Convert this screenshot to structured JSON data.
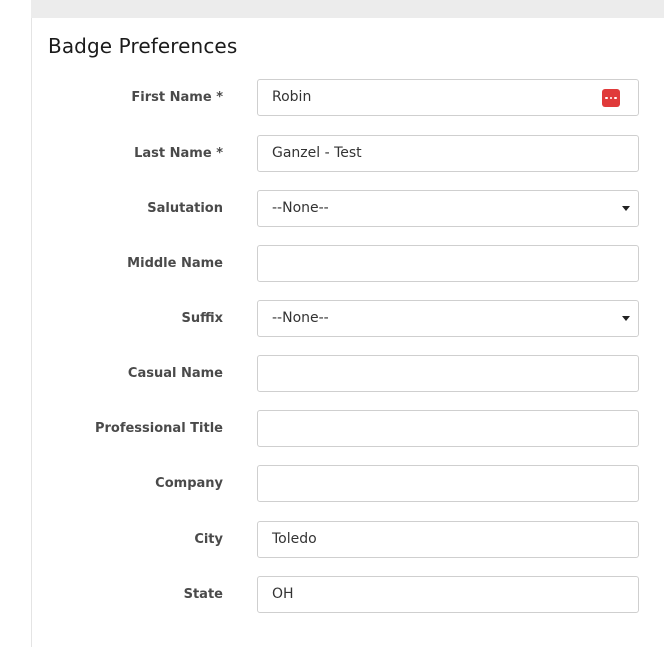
{
  "section_title": "Badge Preferences",
  "colors": {
    "top_strip": "#ececec",
    "label_text": "#4a4a4a",
    "field_border": "#cfcfcf",
    "password_icon": "#e03a3a"
  },
  "fields": {
    "first_name": {
      "label": "First Name *",
      "value": "Robin",
      "icon": "password-manager-icon"
    },
    "last_name": {
      "label": "Last Name *",
      "value": "Ganzel - Test"
    },
    "salutation": {
      "label": "Salutation",
      "value": "--None--"
    },
    "middle_name": {
      "label": "Middle Name",
      "value": ""
    },
    "suffix": {
      "label": "Suffix",
      "value": "--None--"
    },
    "casual_name": {
      "label": "Casual Name",
      "value": ""
    },
    "professional_title": {
      "label": "Professional Title",
      "value": ""
    },
    "company": {
      "label": "Company",
      "value": ""
    },
    "city": {
      "label": "City",
      "value": "Toledo"
    },
    "state": {
      "label": "State",
      "value": "OH"
    }
  }
}
